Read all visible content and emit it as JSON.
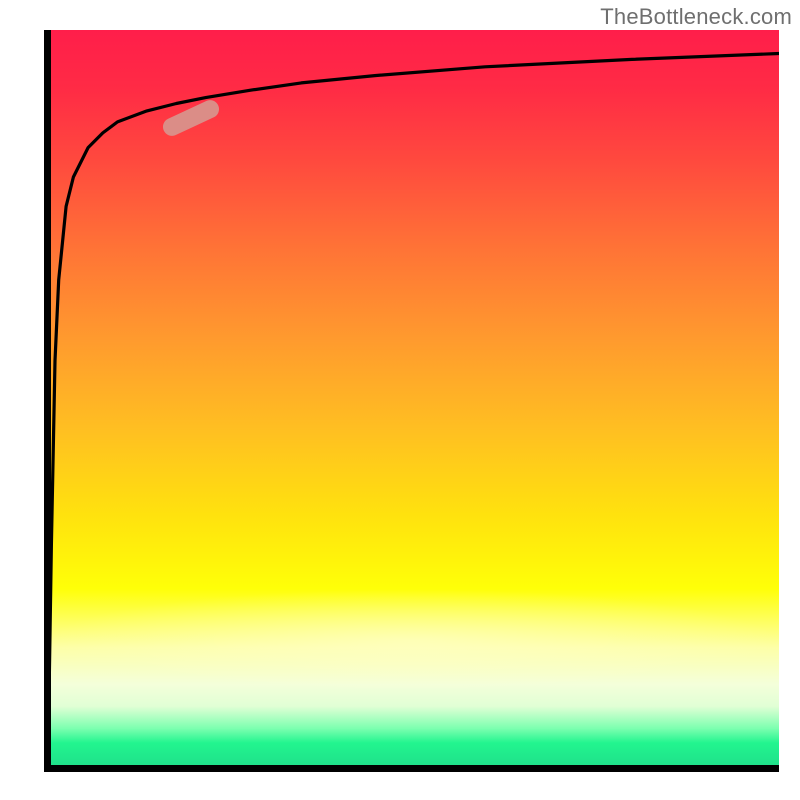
{
  "watermark": "TheBottleneck.com",
  "colors": {
    "axis": "#000000",
    "curve": "#000000",
    "marker": "#db8d87",
    "gradient_top": "#ff1e4a",
    "gradient_bottom": "#1fe18a"
  },
  "chart_data": {
    "type": "line",
    "title": "",
    "xlabel": "",
    "ylabel": "",
    "xlim": [
      0,
      100
    ],
    "ylim": [
      0,
      100
    ],
    "gridlines": false,
    "legend": false,
    "annotations": [
      {
        "kind": "marker-dash",
        "x": 20,
        "y": 88,
        "angle_deg": -25,
        "note": "highlighted segment on curve"
      }
    ],
    "series": [
      {
        "name": "curve",
        "x": [
          0.5,
          0.7,
          1.0,
          1.5,
          2.0,
          3.0,
          4.0,
          6.0,
          8.0,
          10.0,
          14.0,
          18.0,
          22.0,
          28.0,
          35.0,
          45.0,
          60.0,
          80.0,
          100.0
        ],
        "y": [
          2.0,
          10.0,
          30.0,
          55.0,
          66.0,
          76.0,
          80.0,
          84.0,
          86.0,
          87.5,
          89.0,
          90.0,
          90.8,
          91.8,
          92.8,
          93.8,
          95.0,
          96.0,
          96.8
        ],
        "note": "values estimated from pixel positions; x/y are percent of plot width/height"
      },
      {
        "name": "initial-drop",
        "x": [
          0.5,
          0.5
        ],
        "y": [
          96.0,
          2.0
        ],
        "note": "near-vertical leading edge from top-left down to origin region"
      }
    ]
  }
}
